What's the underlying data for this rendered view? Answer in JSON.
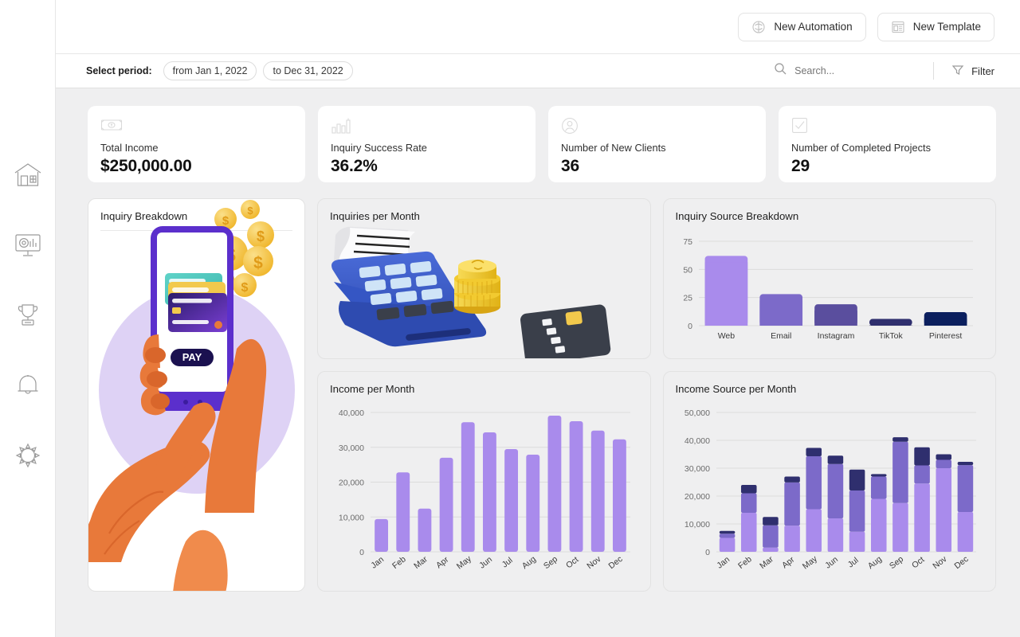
{
  "sidebar": {
    "items": [
      {
        "name": "home",
        "icon": "home-icon"
      },
      {
        "name": "dashboard",
        "icon": "monitor-chart-icon"
      },
      {
        "name": "achievements",
        "icon": "trophy-icon"
      },
      {
        "name": "notifications",
        "icon": "bell-icon"
      },
      {
        "name": "settings",
        "icon": "gear-icon"
      }
    ]
  },
  "topbar": {
    "new_automation_label": "New Automation",
    "new_automation_icon": "automation-icon",
    "new_template_label": "New Template",
    "new_template_icon": "template-icon"
  },
  "filterbar": {
    "select_period_label": "Select period:",
    "period_from": "from Jan 1, 2022",
    "period_to": "to Dec 31, 2022",
    "search_placeholder": "Search...",
    "search_value": "",
    "search_icon": "search-icon",
    "filter_label": "Filter",
    "filter_icon": "funnel-icon"
  },
  "kpis": [
    {
      "label": "Total Income",
      "value": "$250,000.00",
      "icon": "banknote-icon"
    },
    {
      "label": "Inquiry Success Rate",
      "value": "36.2%",
      "icon": "bar-chart-icon"
    },
    {
      "label": "Number of New Clients",
      "value": "36",
      "icon": "user-circle-icon"
    },
    {
      "label": "Number of Completed Projects",
      "value": "29",
      "icon": "checkbox-icon"
    }
  ],
  "panels": {
    "inquiry_breakdown_title": "Inquiry Breakdown",
    "inquiries_per_month_title": "Inquiries per Month",
    "inquiry_source_title": "Inquiry Source Breakdown",
    "income_per_month_title": "Income per Month",
    "income_source_title": "Income Source per Month"
  },
  "illustrations": {
    "inquiry_breakdown": {
      "name": "mobile-payment-illustration",
      "pay_button_label": "PAY",
      "colors": {
        "skin": "#E8793A",
        "skin_dark": "#D9662B",
        "phone": "#5B2FCC",
        "blob": "#DED2F5",
        "coin": "#F5C542"
      }
    },
    "inquiries_per_month": {
      "name": "pos-terminal-illustration",
      "colors": {
        "terminal": "#3556C4",
        "terminal_dark": "#2A45A5",
        "key": "#CFE4F7",
        "key_dark": "#3A3F4A",
        "coin": "#F2CA30",
        "card": "#3A3F4A",
        "chip": "#F2C94C"
      }
    }
  },
  "chart_data": [
    {
      "type": "bar",
      "title": "Inquiry Source Breakdown",
      "categories": [
        "Web",
        "Email",
        "Instagram",
        "TikTok",
        "Pinterest"
      ],
      "values": [
        62,
        28,
        19,
        6,
        12
      ],
      "colors": [
        "#A98BEC",
        "#7C6AC9",
        "#5A4E9E",
        "#2F2F6E",
        "#0B1F5E"
      ],
      "yticks": [
        0,
        25,
        50,
        75
      ],
      "ylim": [
        0,
        75
      ],
      "xlabel": "",
      "ylabel": "",
      "grid": true,
      "legend": "none"
    },
    {
      "type": "bar",
      "title": "Income per Month",
      "categories": [
        "Jan",
        "Feb",
        "Mar",
        "Apr",
        "May",
        "Jun",
        "Jul",
        "Aug",
        "Sep",
        "Oct",
        "Nov",
        "Dec"
      ],
      "values": [
        9400,
        22800,
        12400,
        27000,
        37200,
        34300,
        29500,
        27900,
        39100,
        37500,
        34800,
        32300
      ],
      "colors": [
        "#A98BEC"
      ],
      "yticks": [
        0,
        10000,
        20000,
        30000,
        40000
      ],
      "yticklabels": [
        "0",
        "10,000",
        "20,000",
        "30,000",
        "40,000"
      ],
      "ylim": [
        0,
        40000
      ],
      "xlabel": "",
      "ylabel": "",
      "grid": true,
      "legend": "none"
    },
    {
      "type": "bar",
      "stacked": true,
      "title": "Income Source per Month",
      "categories": [
        "Jan",
        "Feb",
        "Mar",
        "Apr",
        "May",
        "Jun",
        "Jul",
        "Aug",
        "Sep",
        "Oct",
        "Nov",
        "Dec"
      ],
      "series": [
        {
          "name": "source-1",
          "color": "#A98BEC",
          "values": [
            5000,
            14000,
            1500,
            9400,
            15300,
            12000,
            7200,
            19000,
            17500,
            24500,
            30000,
            14300
          ]
        },
        {
          "name": "source-2",
          "color": "#7C6AC9",
          "values": [
            1500,
            7000,
            8000,
            15500,
            19000,
            19500,
            14800,
            8000,
            22000,
            6500,
            3000,
            16800
          ]
        },
        {
          "name": "source-3",
          "color": "#2F2F6E",
          "values": [
            1000,
            3000,
            3000,
            2100,
            3000,
            3000,
            7500,
            900,
            1600,
            6500,
            2000,
            1200
          ]
        }
      ],
      "totals": [
        7500,
        24000,
        12500,
        27000,
        37300,
        34500,
        29500,
        27900,
        41100,
        37500,
        35000,
        32300
      ],
      "yticks": [
        0,
        10000,
        20000,
        30000,
        40000,
        50000
      ],
      "yticklabels": [
        "0",
        "10,000",
        "20,000",
        "30,000",
        "40,000",
        "50,000"
      ],
      "ylim": [
        0,
        50000
      ],
      "xlabel": "",
      "ylabel": "",
      "grid": true,
      "legend": "none"
    }
  ]
}
